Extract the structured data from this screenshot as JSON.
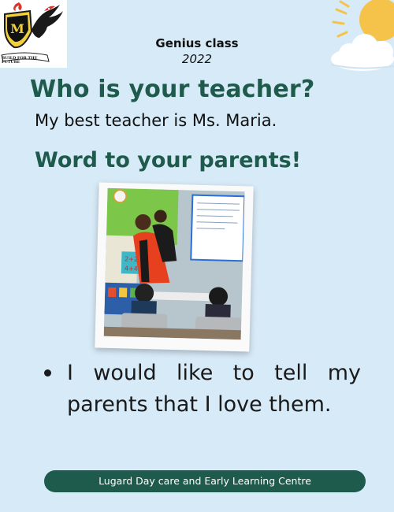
{
  "logo": {
    "motto": "BUILD FOR THE FUTURE"
  },
  "header": {
    "class_name": "Genius class",
    "year": "2022"
  },
  "question_teacher": {
    "heading": "Who is your teacher?",
    "answer": "My best teacher is Ms. Maria."
  },
  "question_parents": {
    "heading": "Word to your parents!"
  },
  "message": {
    "bullet": "I would like to tell my parents that I love them."
  },
  "footer": {
    "school": "Lugard Day care and Early Learning Centre"
  },
  "colors": {
    "background": "#d7eaf7",
    "heading": "#1e5b4c",
    "footer_bg": "#1e5b4c",
    "sun": "#f6c34a"
  }
}
